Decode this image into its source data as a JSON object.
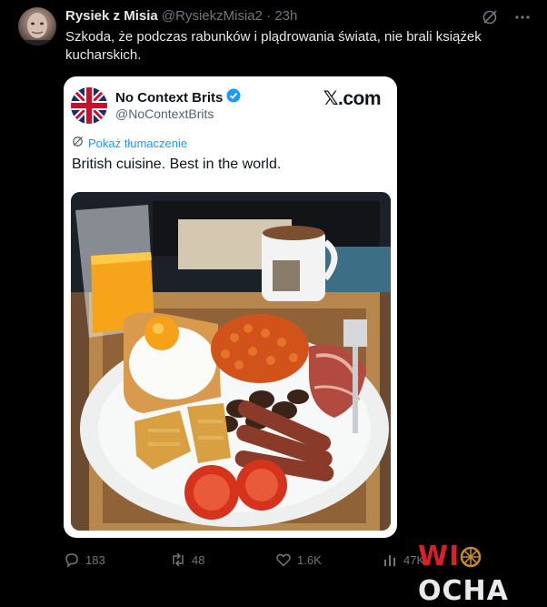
{
  "tweet": {
    "author_name": "Rysiek z Misia",
    "author_handle": "@RysiekzMisia2",
    "separator": "·",
    "time": "23h",
    "text": "Szkoda, że podczas rabunków i plądrowania świata, nie brali książek kucharskich."
  },
  "quote": {
    "name": "No Context Brits",
    "handle": "@NoContextBrits",
    "brand": "𝕏.com",
    "translate_label": "Pokaż tłumaczenie",
    "text": "British cuisine. Best in the world."
  },
  "actions": {
    "replies": "183",
    "reposts": "48",
    "likes": "1.6K",
    "views": "47K"
  },
  "watermark": {
    "part1": "W",
    "part2": "I",
    "part3": "OCHA"
  },
  "colors": {
    "accent": "#1d9bf0",
    "verified": "#1d9bf0",
    "watermark_red": "#d8202a"
  }
}
